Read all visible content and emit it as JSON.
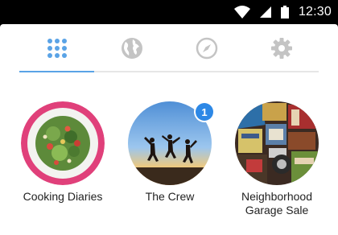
{
  "status_bar": {
    "time": "12:30",
    "icons": [
      "wifi-icon",
      "signal-icon",
      "battery-icon"
    ]
  },
  "tabs": [
    {
      "icon": "apps-grid-icon",
      "active": true
    },
    {
      "icon": "globe-icon",
      "active": false
    },
    {
      "icon": "compass-icon",
      "active": false
    },
    {
      "icon": "gear-icon",
      "active": false
    }
  ],
  "colors": {
    "accent": "#5aa3e6",
    "inactive_icon": "#c4c4c4",
    "badge": "#2d88e6",
    "ring": "#e0407a"
  },
  "groups": [
    {
      "name": "Cooking Diaries",
      "badge": null,
      "image": "salad-plate"
    },
    {
      "name": "The Crew",
      "badge": "1",
      "image": "friends-jumping-sunset"
    },
    {
      "name": "Neighborhood\nGarage Sale",
      "badge": null,
      "image": "garage-sale-items"
    }
  ]
}
